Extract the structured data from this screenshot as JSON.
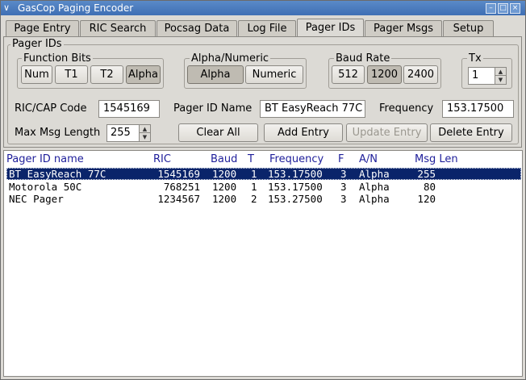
{
  "window": {
    "title": "GasCop Paging Encoder"
  },
  "tabs": [
    {
      "label": "Page Entry"
    },
    {
      "label": "RIC Search"
    },
    {
      "label": "Pocsag Data"
    },
    {
      "label": "Log File"
    },
    {
      "label": "Pager IDs"
    },
    {
      "label": "Pager Msgs"
    },
    {
      "label": "Setup"
    }
  ],
  "panel": {
    "title": "Pager IDs",
    "function_bits": {
      "label": "Function Bits",
      "buttons": [
        "Num",
        "T1",
        "T2",
        "Alpha"
      ],
      "selected": "Alpha"
    },
    "alpha_numeric": {
      "label": "Alpha/Numeric",
      "buttons": [
        "Alpha",
        "Numeric"
      ],
      "selected": "Alpha"
    },
    "baud_rate": {
      "label": "Baud Rate",
      "buttons": [
        "512",
        "1200",
        "2400"
      ],
      "selected": "1200"
    },
    "tx": {
      "label": "Tx",
      "value": "1"
    },
    "ric_cap_code": {
      "label": "RIC/CAP Code",
      "value": "1545169"
    },
    "pager_id_name": {
      "label": "Pager ID Name",
      "value": "BT EasyReach 77C"
    },
    "frequency": {
      "label": "Frequency",
      "value": "153.17500"
    },
    "max_msg_length": {
      "label": "Max Msg Length",
      "value": "255"
    },
    "actions": {
      "clear_all": "Clear All",
      "add_entry": "Add Entry",
      "update_entry": "Update Entry",
      "delete_entry": "Delete Entry"
    }
  },
  "table": {
    "columns": [
      "Pager ID name",
      "RIC",
      "Baud",
      "T",
      "Frequency",
      "F",
      "A/N",
      "Msg Len"
    ],
    "rows": [
      {
        "name": "BT EasyReach 77C",
        "ric": "1545169",
        "baud": "1200",
        "t": "1",
        "frequency": "153.17500",
        "f": "3",
        "an": "Alpha",
        "msglen": "255",
        "selected": true
      },
      {
        "name": "Motorola 50C",
        "ric": "768251",
        "baud": "1200",
        "t": "1",
        "frequency": "153.17500",
        "f": "3",
        "an": "Alpha",
        "msglen": "80",
        "selected": false
      },
      {
        "name": "NEC Pager",
        "ric": "1234567",
        "baud": "1200",
        "t": "2",
        "frequency": "153.27500",
        "f": "3",
        "an": "Alpha",
        "msglen": "120",
        "selected": false
      }
    ]
  },
  "colors": {
    "title_bar": "#4a7cc0",
    "selection": "#0a246a",
    "header_text": "#1e1e9a"
  }
}
